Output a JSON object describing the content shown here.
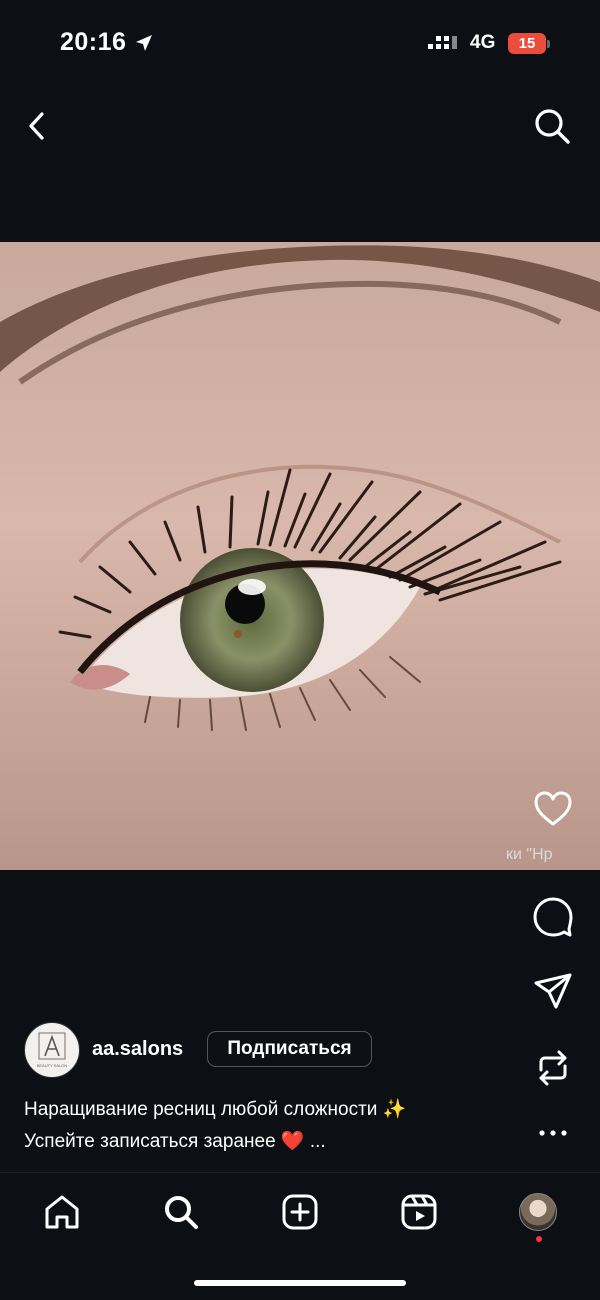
{
  "status_bar": {
    "time": "20:16",
    "network": "4G",
    "battery": "15"
  },
  "post": {
    "username": "aa.salons",
    "follow_label": "Подписаться",
    "avatar_text": "BEAUTY SALON",
    "caption_line1": "Наращивание ресниц любой сложности ✨",
    "caption_line2": "Успейте записаться заранее ❤️ ...",
    "audio_label": "ки \"Нр"
  },
  "icons": {
    "back": "chevron-left-icon",
    "search": "search-icon",
    "like": "heart-icon",
    "comment": "comment-icon",
    "share": "paper-plane-icon",
    "remix": "repost-icon",
    "more": "more-icon",
    "home": "home-icon",
    "explore": "search-icon",
    "create": "plus-square-icon",
    "reels": "reels-icon",
    "profile": "avatar"
  },
  "colors": {
    "background": "#0c1014",
    "battery": "#eb4d3d",
    "notification": "#ff3040"
  }
}
